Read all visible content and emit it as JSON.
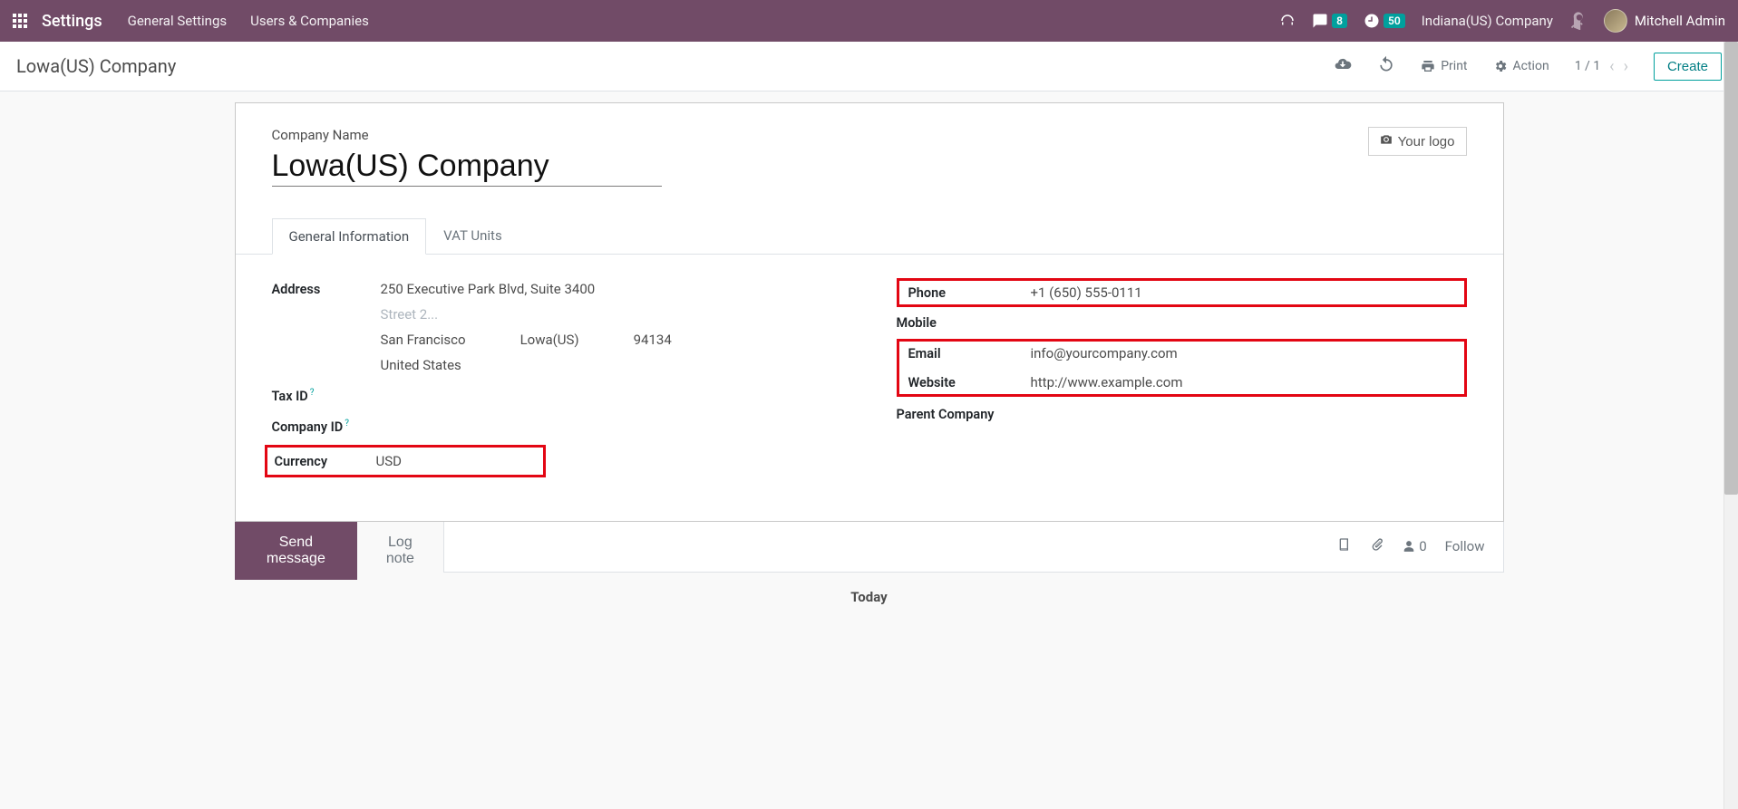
{
  "navbar": {
    "brand": "Settings",
    "links": {
      "general": "General Settings",
      "users": "Users & Companies"
    },
    "messages_badge": "8",
    "activities_badge": "50",
    "company": "Indiana(US) Company",
    "user_name": "Mitchell Admin"
  },
  "control": {
    "title": "Lowa(US) Company",
    "print": "Print",
    "action": "Action",
    "pager": "1 / 1",
    "create": "Create"
  },
  "form": {
    "company_label": "Company Name",
    "company_value": "Lowa(US) Company",
    "logo_btn": "Your logo",
    "tabs": {
      "general": "General Information",
      "vat": "VAT Units"
    },
    "labels": {
      "address": "Address",
      "taxid": "Tax ID",
      "companyid": "Company ID",
      "currency": "Currency",
      "phone": "Phone",
      "mobile": "Mobile",
      "email": "Email",
      "website": "Website",
      "parent": "Parent Company"
    },
    "address": {
      "street": "250 Executive Park Blvd, Suite 3400",
      "street2_placeholder": "Street 2...",
      "city": "San Francisco",
      "state": "Lowa(US)",
      "zip": "94134",
      "country": "United States"
    },
    "currency": "USD",
    "phone": "+1 (650) 555-0111",
    "email": "info@yourcompany.com",
    "website": "http://www.example.com"
  },
  "chatter": {
    "send": "Send message",
    "lognote": "Log note",
    "followers_count": "0",
    "follow": "Follow",
    "today": "Today"
  },
  "highlight_color": "#e30613"
}
